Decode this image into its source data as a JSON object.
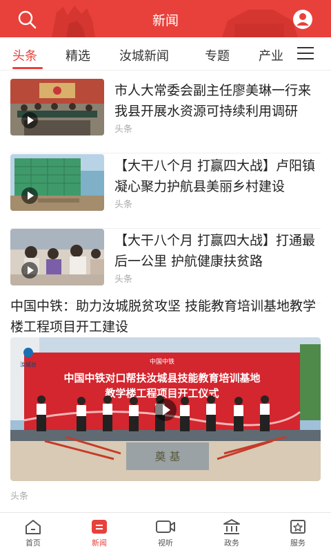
{
  "header": {
    "title": "新闻",
    "search_icon": "search-icon",
    "user_icon": "user-icon",
    "accent_color": "#e8413b"
  },
  "tabs": [
    {
      "label": "头条",
      "active": true
    },
    {
      "label": "精选",
      "active": false
    },
    {
      "label": "汝城新闻",
      "active": false
    },
    {
      "label": "专题",
      "active": false
    },
    {
      "label": "产业",
      "active": false
    }
  ],
  "tabs_menu_icon": "menu-icon",
  "news": [
    {
      "headline": "市人大常委会副主任廖美琳一行来我县开展水资源可持续利用调研",
      "source": "头条",
      "has_video": true
    },
    {
      "headline": "【大干八个月 打赢四大战】卢阳镇凝心聚力护航县美丽乡村建设",
      "source": "头条",
      "has_video": true
    },
    {
      "headline": "【大干八个月 打赢四大战】打通最后一公里 护航健康扶贫路",
      "source": "头条",
      "has_video": true
    }
  ],
  "featured": {
    "headline": "中国中铁：助力汝城脱贫攻坚 技能教育培训基地教学楼工程项目开工建设",
    "source": "头条",
    "has_video": true,
    "banner_small": "中国中铁",
    "banner_line1": "中国中铁对口帮扶汝城县技能教育培训基地",
    "banner_line2": "教学楼工程项目开工仪式",
    "station_logo": "汝城台",
    "stone_text": "奠 基"
  },
  "bottom_nav": [
    {
      "label": "首页",
      "icon": "home-icon",
      "active": false
    },
    {
      "label": "新闻",
      "icon": "news-icon",
      "active": true
    },
    {
      "label": "视听",
      "icon": "video-icon",
      "active": false
    },
    {
      "label": "政务",
      "icon": "government-icon",
      "active": false
    },
    {
      "label": "服务",
      "icon": "service-icon",
      "active": false
    }
  ]
}
